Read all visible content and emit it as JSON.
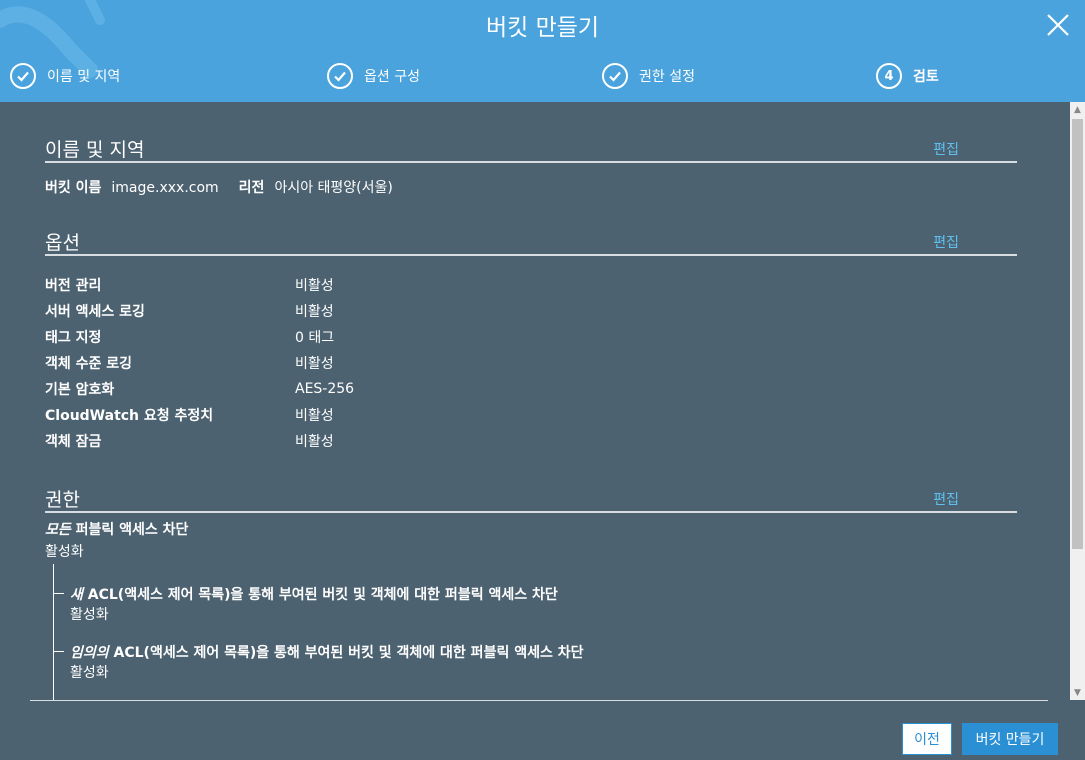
{
  "header": {
    "title": "버킷 만들기",
    "steps": [
      {
        "label": "이름 및 지역",
        "status": "done"
      },
      {
        "label": "옵션 구성",
        "status": "done"
      },
      {
        "label": "권한 설정",
        "status": "done"
      },
      {
        "number": "4",
        "label": "검토",
        "status": "active"
      }
    ]
  },
  "sections": {
    "name_region": {
      "title": "이름 및 지역",
      "edit": "편집",
      "bucket_name_label": "버킷 이름",
      "bucket_name_value": "image.xxx.com",
      "region_label": "리전",
      "region_value": "아시아 태평양(서울)"
    },
    "options": {
      "title": "옵션",
      "edit": "편집",
      "rows": [
        {
          "k": "버전 관리",
          "v": "비활성"
        },
        {
          "k": "서버 액세스 로깅",
          "v": "비활성"
        },
        {
          "k": "태그 지정",
          "v": "0 태그"
        },
        {
          "k": "객체 수준 로깅",
          "v": "비활성"
        },
        {
          "k": "기본 암호화",
          "v": "AES-256"
        },
        {
          "k": "CloudWatch 요청 추정치",
          "v": "비활성"
        },
        {
          "k": "객체 잠금",
          "v": "비활성"
        }
      ]
    },
    "permissions": {
      "title": "권한",
      "edit": "편집",
      "block_all_em": "모든",
      "block_all_rest": " 퍼블릭 액세스 차단",
      "block_all_value": "활성화",
      "items": [
        {
          "em": "새",
          "rest": " ACL(액세스 제어 목록)을 통해 부여된 버킷 및 객체에 대한 퍼블릭 액세스 차단",
          "value": "활성화"
        },
        {
          "em": "임의의",
          "rest": " ACL(액세스 제어 목록)을 통해 부여된 버킷 및 객체에 대한 퍼블릭 액세스 차단",
          "value": "활성화"
        }
      ]
    }
  },
  "footer": {
    "prev_label": "이전",
    "create_label": "버킷 만들기"
  },
  "colors": {
    "header_bg": "#4aa3dc",
    "content_bg": "#4d6270",
    "link": "#5fc0f0",
    "primary_button": "#2b8fd4"
  }
}
